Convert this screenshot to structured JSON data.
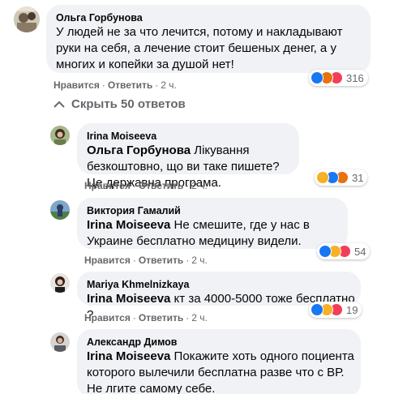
{
  "colors": {
    "like": "#1877f2",
    "haha": "#f7b125",
    "angry": "#e9710f",
    "love": "#f33e58",
    "secondary_text": "#65676b",
    "bubble": "#f0f2f5"
  },
  "main_comment": {
    "author": "Ольга Горбунова",
    "text": "У людей не за что лечится, потому и накладывают руки на себя, а лечение стоит бешеных денег, а у многих и копейки за душой нет!",
    "like": "Нравится",
    "reply": "Ответить",
    "time": "2 ч.",
    "reaction_icons": [
      "like-icon",
      "angry-icon",
      "love-icon"
    ],
    "reaction_count": "316"
  },
  "hide_replies_label": "Скрыть 50 ответов",
  "replies": [
    {
      "author": "Irina Moiseeva",
      "mention": "Ольга Горбунова",
      "text": " Лікування безкоштовно, що ви таке пишете? Це державна програма.",
      "like": "Нравится",
      "reply": "Ответить",
      "time": "2 ч.",
      "reaction_icons": [
        "haha-icon",
        "like-icon",
        "angry-icon"
      ],
      "reaction_count": "31"
    },
    {
      "author": "Виктория Гамалий",
      "mention": "Irina Moiseeva",
      "text": " Не смешите, где у нас в Украине бесплатно медицину видели.",
      "like": "Нравится",
      "reply": "Ответить",
      "time": "2 ч.",
      "reaction_icons": [
        "like-icon",
        "haha-icon",
        "love-icon"
      ],
      "reaction_count": "54"
    },
    {
      "author": "Mariya Khmelnizkaya",
      "mention": "Irina Moiseeva",
      "text": " кт за 4000-5000 тоже бесплатно ?",
      "like": "Нравится",
      "reply": "Ответить",
      "time": "2 ч.",
      "reaction_icons": [
        "like-icon",
        "haha-icon",
        "love-icon"
      ],
      "reaction_count": "19"
    },
    {
      "author": "Александр Димов",
      "mention": "Irina Moiseeva",
      "text": " Покажите хоть одного поциента которого вылечили бесплатна разве что с ВР. Не лгите самому себе."
    }
  ]
}
